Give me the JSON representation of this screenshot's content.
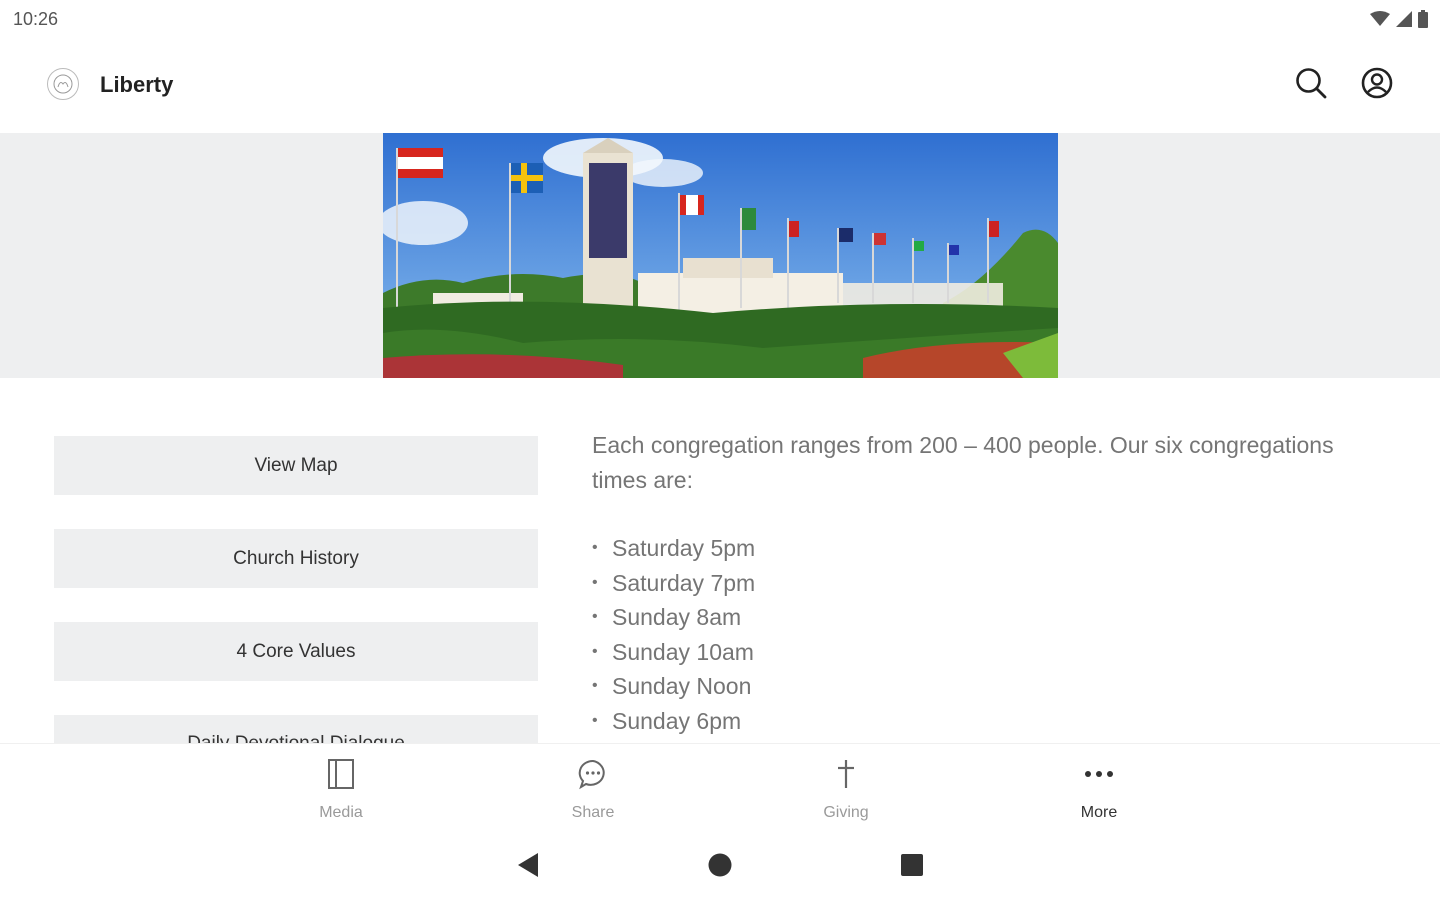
{
  "status_bar": {
    "time": "10:26",
    "icons": [
      "wifi-icon",
      "signal-icon",
      "battery-icon"
    ]
  },
  "app_bar": {
    "title": "Liberty",
    "logo_icon": "church-logo-icon",
    "actions": [
      "search-icon",
      "account-icon"
    ]
  },
  "banner": {
    "subject": "church-campus-with-flags-photo"
  },
  "left_buttons": [
    {
      "label": "View Map"
    },
    {
      "label": "Church History"
    },
    {
      "label": "4 Core Values"
    },
    {
      "label": "Daily Devotional Dialogue"
    }
  ],
  "content": {
    "intro": "Each congregation ranges from 200 – 400 people.  Our six congregations times are:",
    "times": [
      "Saturday 5pm",
      "Saturday 7pm",
      "Sunday 8am",
      "Sunday 10am",
      "Sunday Noon",
      "Sunday 6pm"
    ]
  },
  "tab_bar": {
    "tabs": [
      {
        "label": "Media",
        "icon": "book-icon",
        "active": false
      },
      {
        "label": "Share",
        "icon": "chat-bubble-icon",
        "active": false
      },
      {
        "label": "Giving",
        "icon": "cross-icon",
        "active": false
      },
      {
        "label": "More",
        "icon": "more-dots-icon",
        "active": true
      }
    ]
  },
  "colors": {
    "background": "#ffffff",
    "button_bg": "#eeeff0",
    "body_text": "#757575",
    "title_text": "#222222",
    "inactive_tab": "#9a9a9a",
    "active_tab": "#333333"
  }
}
